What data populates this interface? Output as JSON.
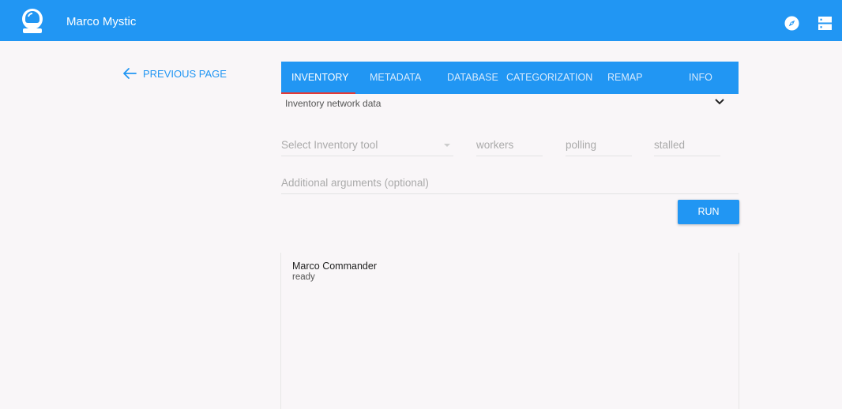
{
  "header": {
    "title": "Marco Mystic",
    "logo_icon": "astronaut-helmet-icon",
    "accent": "#2196f3"
  },
  "nav": {
    "previous_page": "PREVIOUS PAGE"
  },
  "tabs": [
    {
      "label": "INVENTORY",
      "active": true
    },
    {
      "label": "METADATA"
    },
    {
      "label": "DATABASE"
    },
    {
      "label": "CATEGORIZATION"
    },
    {
      "label": "REMAP"
    },
    {
      "label": "INFO"
    }
  ],
  "sub_select": {
    "value": "Inventory network data"
  },
  "form": {
    "tool_placeholder": "Select Inventory tool",
    "workers_placeholder": "workers",
    "polling_placeholder": "polling",
    "stalled_placeholder": "stalled",
    "args_placeholder": "Additional arguments (optional)",
    "run_label": "RUN"
  },
  "console": {
    "name": "Marco Commander",
    "status": "ready"
  }
}
